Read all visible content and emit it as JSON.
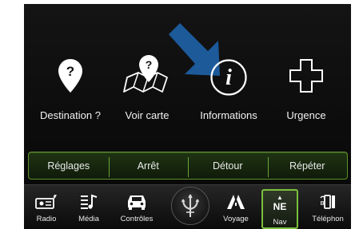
{
  "main_menu": {
    "items": [
      {
        "label": "Destination ?",
        "icon": "location-question-icon"
      },
      {
        "label": "Voir carte",
        "icon": "map-question-icon"
      },
      {
        "label": "Informations",
        "icon": "info-icon"
      },
      {
        "label": "Urgence",
        "icon": "emergency-cross-icon"
      }
    ]
  },
  "softkeys": [
    "Réglages",
    "Arrêt",
    "Détour",
    "Répéter"
  ],
  "bottom_bar": {
    "items": [
      {
        "label": "Radio",
        "icon": "radio-icon"
      },
      {
        "label": "Média",
        "icon": "media-icon"
      },
      {
        "label": "Contrôles",
        "icon": "car-controls-icon"
      },
      {
        "label": "Voyage",
        "icon": "road-icon"
      },
      {
        "label": "Nav",
        "icon": "compass-icon",
        "compass": "NE",
        "active": true
      },
      {
        "label": "Téléphon",
        "icon": "phone-icon"
      }
    ]
  },
  "colors": {
    "accent": "#7cc03d",
    "arrow": "#1c5a9a",
    "background": "#0e0e0e"
  }
}
